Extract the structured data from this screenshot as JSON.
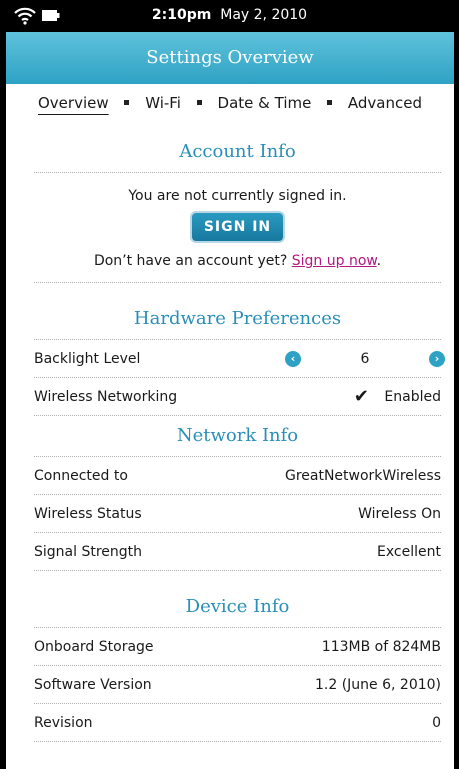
{
  "status_bar": {
    "time": "2:10pm",
    "date": "May 2, 2010"
  },
  "header": {
    "title": "Settings Overview"
  },
  "tabs": [
    {
      "label": "Overview"
    },
    {
      "label": "Wi-Fi"
    },
    {
      "label": "Date & Time"
    },
    {
      "label": "Advanced"
    }
  ],
  "account": {
    "title": "Account Info",
    "message": "You are not currently signed in.",
    "signin_label": "SIGN IN",
    "no_account_text": "Don’t have an account yet?",
    "signup_label": "Sign up now",
    "signup_suffix": "."
  },
  "hardware": {
    "title": "Hardware Preferences",
    "backlight": {
      "label": "Backlight Level",
      "value": "6"
    },
    "wireless": {
      "label": "Wireless Networking",
      "check": "✔",
      "state": "Enabled"
    }
  },
  "network": {
    "title": "Network Info",
    "rows": [
      {
        "label": "Connected to",
        "value": "GreatNetworkWireless"
      },
      {
        "label": "Wireless Status",
        "value": "Wireless On"
      },
      {
        "label": "Signal Strength",
        "value": "Excellent"
      }
    ]
  },
  "device": {
    "title": "Device Info",
    "rows": [
      {
        "label": "Onboard Storage",
        "value": "113MB of 824MB"
      },
      {
        "label": "Software Version",
        "value": "1.2 (June 6, 2010)"
      },
      {
        "label": "Revision",
        "value": "0"
      }
    ]
  },
  "icons": {
    "left_arrow": "‹",
    "right_arrow": "›"
  },
  "colors": {
    "accent": "#2ea2c4",
    "section_title": "#2a8fb8",
    "link": "#b0187f"
  }
}
